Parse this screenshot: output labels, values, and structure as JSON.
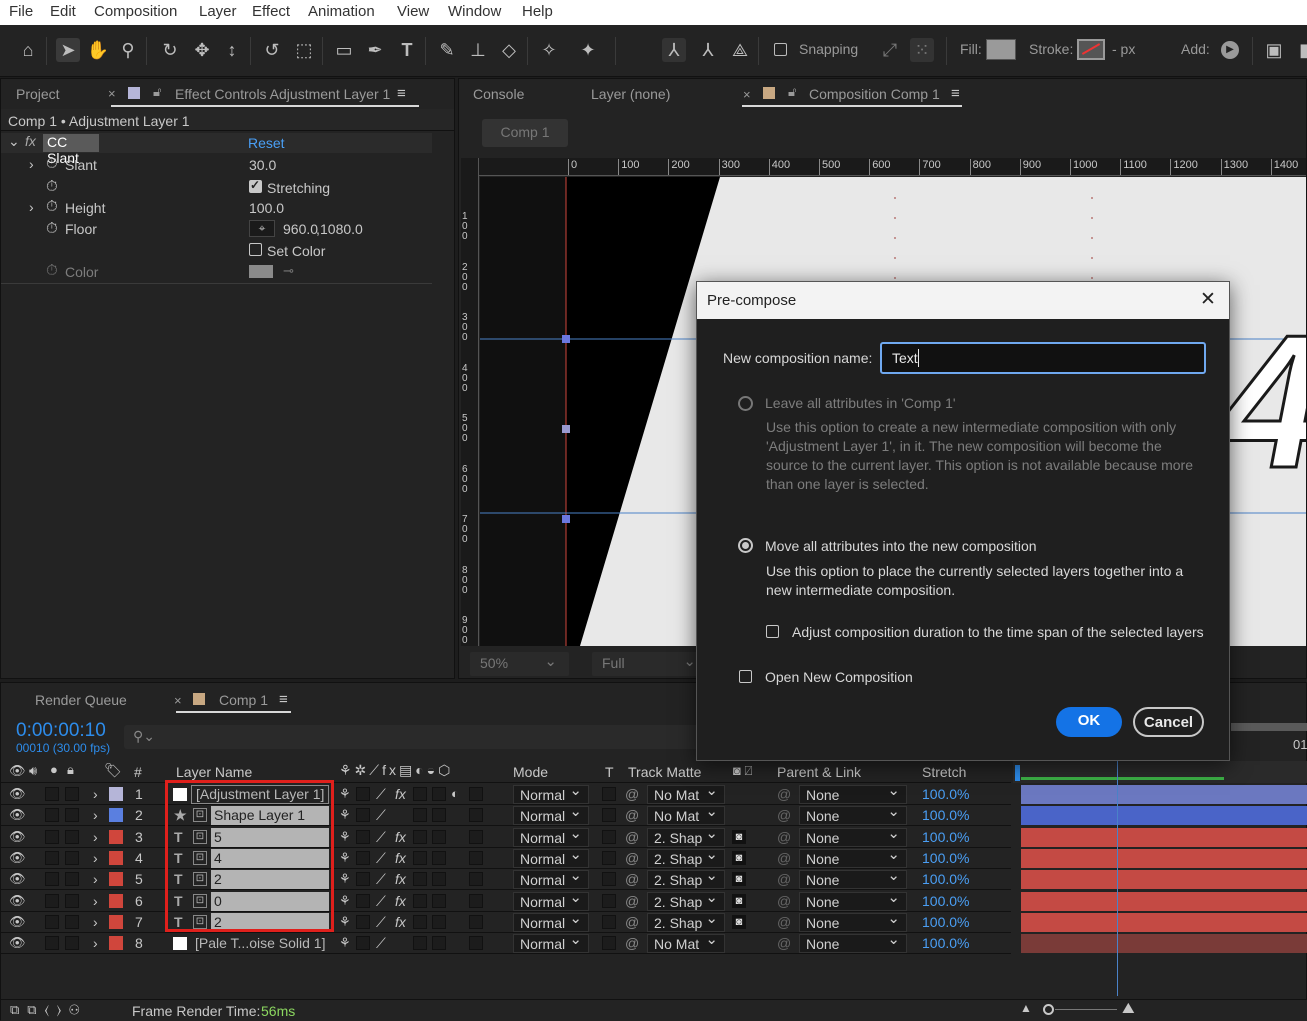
{
  "menu": [
    "File",
    "Edit",
    "Composition",
    "Layer",
    "Effect",
    "Animation",
    "View",
    "Window",
    "Help"
  ],
  "toolbar": {
    "snapping_label": "Snapping",
    "fill_label": "Fill:",
    "stroke_label": "Stroke:",
    "stroke_px": "- px",
    "add_label": "Add:"
  },
  "project_panel": {
    "tab_project": "Project",
    "tab_effect_controls": "Effect Controls Adjustment Layer 1",
    "breadcrumb": "Comp 1 • Adjustment Layer 1",
    "effect_name": "CC Slant",
    "reset_label": "Reset",
    "props": [
      {
        "name": "Slant",
        "value": "30.0"
      },
      {
        "name": "Stretching",
        "checked": true
      },
      {
        "name": "Height",
        "value": "100.0"
      },
      {
        "name": "Floor",
        "value_x": "960.0",
        "value_y": "1080.0"
      },
      {
        "name": "Set Color",
        "checked": false
      },
      {
        "name": "Color"
      }
    ]
  },
  "viewer": {
    "tab_console": "Console",
    "tab_layer": "Layer (none)",
    "tab_comp": "Composition Comp 1",
    "comp_button": "Comp 1",
    "ruler_h": [
      "0",
      "100",
      "200",
      "300",
      "400",
      "500",
      "600",
      "700",
      "800",
      "900",
      "1000",
      "1100",
      "1200",
      "1300",
      "1400"
    ],
    "ruler_v": [
      "100",
      "200",
      "300",
      "400",
      "500",
      "600",
      "700",
      "800",
      "900"
    ],
    "zoom": "50%",
    "resolution": "Full",
    "visible_glyph": "4"
  },
  "dialog": {
    "title": "Pre-compose",
    "name_label": "New composition name:",
    "name_value": "Text",
    "option1_label": "Leave all attributes in 'Comp 1'",
    "option1_desc": "Use this option to create a new intermediate composition with only 'Adjustment Layer 1', in it. The new composition will become the source to the current layer. This option is not available because more than one layer is selected.",
    "option2_label": "Move all attributes into the new composition",
    "option2_desc": "Use this option to place the currently selected layers together into a new intermediate composition.",
    "adjust_duration_label": "Adjust composition duration to the time span of the selected layers",
    "open_new_label": "Open New Composition",
    "ok_label": "OK",
    "cancel_label": "Cancel"
  },
  "timeline": {
    "tab_render_queue": "Render Queue",
    "tab_comp": "Comp 1",
    "timecode": "0:00:00:10",
    "frame_info": "00010 (30.00 fps)",
    "ruler_label": "01",
    "columns": {
      "num": "#",
      "layer_name": "Layer Name",
      "mode": "Mode",
      "t": "T",
      "track_matte": "Track Matte",
      "parent": "Parent & Link",
      "stretch": "Stretch"
    },
    "layers": [
      {
        "num": "1",
        "type": "adjust",
        "name": "[Adjustment Layer 1]",
        "label_color": "#b5b5d8",
        "mode": "Normal",
        "matte": "No Mat",
        "parent": "None",
        "stretch": "100.0%",
        "bar": "#6b78c0"
      },
      {
        "num": "2",
        "type": "shape",
        "name": "Shape Layer 1",
        "label_color": "#5a7fe0",
        "mode": "Normal",
        "matte": "No Mat",
        "parent": "None",
        "stretch": "100.0%",
        "bar": "#4a64c8"
      },
      {
        "num": "3",
        "type": "text",
        "name": "5",
        "label_color": "#d0463c",
        "mode": "Normal",
        "matte": "2. Shap",
        "parent": "None",
        "stretch": "100.0%",
        "bar": "#c44a44"
      },
      {
        "num": "4",
        "type": "text",
        "name": "4",
        "label_color": "#d0463c",
        "mode": "Normal",
        "matte": "2. Shap",
        "parent": "None",
        "stretch": "100.0%",
        "bar": "#c44a44"
      },
      {
        "num": "5",
        "type": "text",
        "name": "2",
        "label_color": "#d0463c",
        "mode": "Normal",
        "matte": "2. Shap",
        "parent": "None",
        "stretch": "100.0%",
        "bar": "#c44a44"
      },
      {
        "num": "6",
        "type": "text",
        "name": "0",
        "label_color": "#d0463c",
        "mode": "Normal",
        "matte": "2. Shap",
        "parent": "None",
        "stretch": "100.0%",
        "bar": "#c44a44"
      },
      {
        "num": "7",
        "type": "text",
        "name": "2",
        "label_color": "#d0463c",
        "mode": "Normal",
        "matte": "2. Shap",
        "parent": "None",
        "stretch": "100.0%",
        "bar": "#c44a44"
      },
      {
        "num": "8",
        "type": "solid",
        "name": "[Pale T...oise Solid 1]",
        "label_color": "#d0463c",
        "mode": "Normal",
        "matte": "No Mat",
        "parent": "None",
        "stretch": "100.0%",
        "bar": "#7a3b38"
      }
    ],
    "footer_label": "Frame Render Time:",
    "footer_value": "56ms"
  },
  "colors": {
    "accent_blue": "#2d8ceb",
    "link_blue": "#4a9ff5",
    "selection_red": "#e0201c",
    "footer_value": "#8cd860"
  }
}
